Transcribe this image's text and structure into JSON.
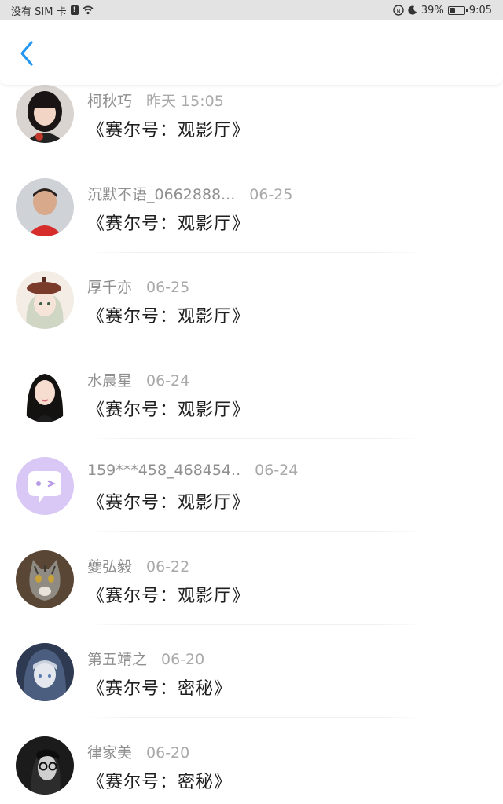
{
  "status_bar": {
    "carrier": "没有 SIM 卡",
    "sim_badge": "!",
    "battery_percent": 39,
    "battery_label": "39%",
    "time": "9:05",
    "icons": [
      "sim-alert-icon",
      "wifi-icon",
      "nfc-icon",
      "moon-icon",
      "battery-icon"
    ]
  },
  "nav": {
    "back_icon": "chevron-left-icon",
    "accent_color": "#2196F3"
  },
  "items": [
    {
      "name": "柯秋巧",
      "time": "昨天 15:05",
      "content": "《赛尔号：观影厅》",
      "avatar": "girl-photo"
    },
    {
      "name": "沉默不语_0662888...",
      "time": "06-25",
      "content": "《赛尔号：观影厅》",
      "avatar": "boy-photo"
    },
    {
      "name": "厚千亦",
      "time": "06-25",
      "content": "《赛尔号：观影厅》",
      "avatar": "anime-girl-beret"
    },
    {
      "name": "水晨星",
      "time": "06-24",
      "content": "《赛尔号：观影厅》",
      "avatar": "woman-photo"
    },
    {
      "name": "159***458_468454..",
      "time": "06-24",
      "content": "《赛尔号：观影厅》",
      "avatar": "default-chat-bubble"
    },
    {
      "name": "夔弘毅",
      "time": "06-22",
      "content": "《赛尔号：观影厅》",
      "avatar": "cat-photo"
    },
    {
      "name": "第五靖之",
      "time": "06-20",
      "content": "《赛尔号：密秘》",
      "avatar": "anime-hooded"
    },
    {
      "name": "律家美",
      "time": "06-20",
      "content": "《赛尔号：密秘》",
      "avatar": "bw-glasses-portrait"
    }
  ]
}
